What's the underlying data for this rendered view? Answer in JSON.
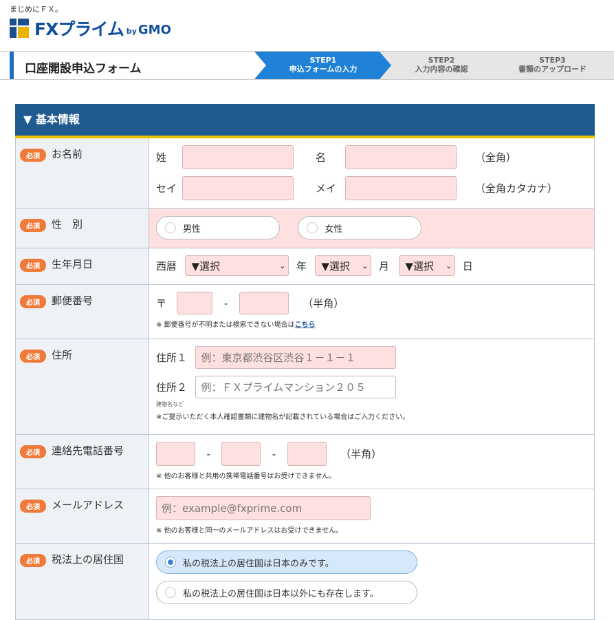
{
  "header": {
    "tagline": "まじめにＦＸ。",
    "logo_text": "FXプライム",
    "logo_by": "by",
    "logo_gmo": "GMO"
  },
  "stepbar": {
    "form_title": "口座開設申込フォーム",
    "steps": [
      {
        "num": "STEP1",
        "label": "申込フォームの入力",
        "active": true
      },
      {
        "num": "STEP2",
        "label": "入力内容の確認",
        "active": false
      },
      {
        "num": "STEP3",
        "label": "書類のアップロード",
        "active": false
      }
    ],
    "active_color": "#1f82d6",
    "inactive_color": "#e6e6e6"
  },
  "section": {
    "title": "▼ 基本情報",
    "required_badge": "必須"
  },
  "name": {
    "label": "お名前",
    "sei": "姓",
    "mei": "名",
    "kanji_note": "（全角）",
    "sei_kana": "セイ",
    "mei_kana": "メイ",
    "kana_note": "（全角カタカナ）"
  },
  "gender": {
    "label": "性　別",
    "options": [
      "男性",
      "女性"
    ]
  },
  "birth": {
    "label": "生年月日",
    "era": "西暦",
    "year_select": "▼選択",
    "year_unit": "年",
    "month_select": "▼選択",
    "month_unit": "月",
    "day_select": "▼選択",
    "day_unit": "日"
  },
  "postal": {
    "label": "郵便番号",
    "mark": "〒",
    "dash": "-",
    "note": "（半角）",
    "help": "※ 郵便番号が不明または検索できない場合は",
    "help_link": "こちら"
  },
  "address": {
    "label": "住所",
    "addr1_label": "住所１",
    "addr1_placeholder": "例：東京都渋谷区渋谷１－１－１",
    "addr2_label": "住所２",
    "addr2_placeholder": "例：ＦＸプライムマンション２０５",
    "addr2_sub": "建物名など",
    "help": "※ご提示いただく本人確認書類に建物名が記載されている場合はご入力ください。"
  },
  "phone": {
    "label": "連絡先電話番号",
    "dash": "-",
    "note": "（半角）",
    "help": "※ 他のお客様と共用の携帯電話番号はお受けできません。"
  },
  "email": {
    "label": "メールアドレス",
    "placeholder": "例：example@fxprime.com",
    "help": "※ 他のお客様と同一のメールアドレスはお受けできません。"
  },
  "tax": {
    "label": "税法上の居住国",
    "options": [
      "私の税法上の居住国は日本のみです。",
      "私の税法上の居住国は日本以外にも存在します。"
    ],
    "selected_index": 0
  }
}
